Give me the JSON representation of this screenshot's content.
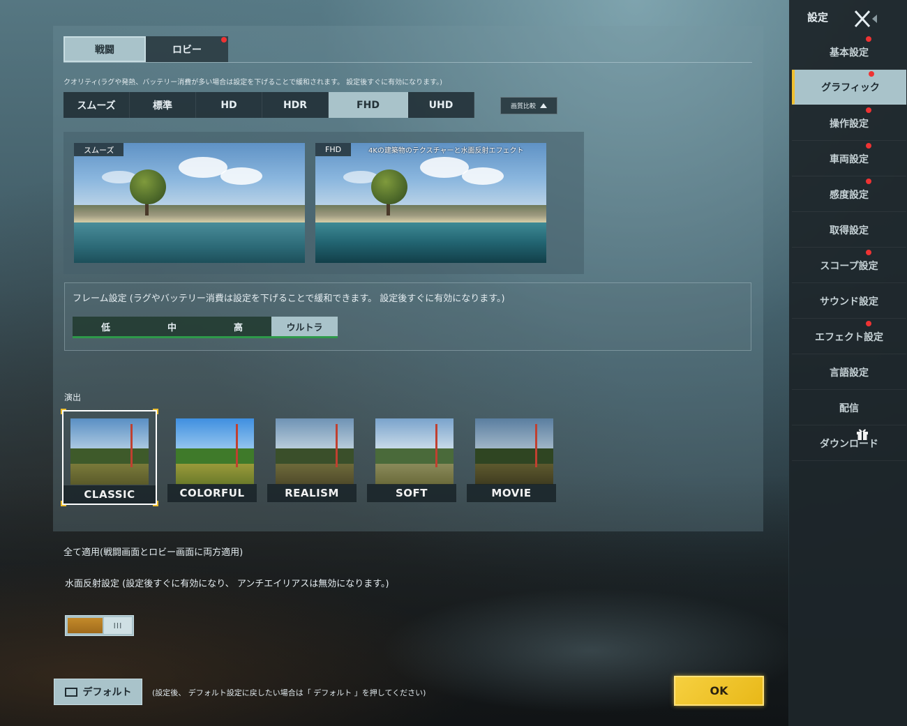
{
  "tabs": [
    {
      "label": "戦闘",
      "active": true
    },
    {
      "label": "ロビー",
      "active": false,
      "badge": true
    }
  ],
  "quality": {
    "note": "クオリティ(ラグや発熱、バッテリー消費が多い場合は設定を下げることで緩和されます。 設定後すぐに有効になります。)",
    "options": [
      "スムーズ",
      "標準",
      "HD",
      "HDR",
      "FHD",
      "UHD"
    ],
    "selected": "FHD",
    "compare_label": "画質比較"
  },
  "preview": {
    "left_label": "スムーズ",
    "right_label": "FHD",
    "right_desc": "4Kの建築物のテクスチャーと水面反射エフェクト"
  },
  "frame": {
    "note": "フレーム設定 (ラグやバッテリー消費は設定を下げることで緩和できます。 設定後すぐに有効になります。)",
    "options": [
      "低",
      "中",
      "高",
      "ウルトラ"
    ],
    "selected": "ウルトラ"
  },
  "style": {
    "title": "演出",
    "options": [
      "CLASSIC",
      "COLORFUL",
      "REALISM",
      "SOFT",
      "MOVIE"
    ],
    "selected": "CLASSIC"
  },
  "apply_all": "全て適用(戦闘画面とロビー画面に両方適用)",
  "water": {
    "note": "水面反射設定 (設定後すぐに有効になり、 アンチエイリアスは無効になります。)",
    "toggle_on": true,
    "knob_glyph": "III"
  },
  "footer": {
    "default_label": "デフォルト",
    "default_note": "(設定後、 デフォルト設定に戻したい場合は「 デフォルト 」を押してください)",
    "ok_label": "OK"
  },
  "sidebar": {
    "title": "設定",
    "items": [
      {
        "label": "基本設定",
        "badge": true
      },
      {
        "label": "グラフィック",
        "badge": true,
        "active": true
      },
      {
        "label": "操作設定",
        "badge": true
      },
      {
        "label": "車両設定",
        "badge": true
      },
      {
        "label": "感度設定",
        "badge": true
      },
      {
        "label": "取得設定",
        "badge": false
      },
      {
        "label": "スコープ設定",
        "badge": true
      },
      {
        "label": "サウンド設定",
        "badge": false
      },
      {
        "label": "エフェクト設定",
        "badge": true
      },
      {
        "label": "言語設定",
        "badge": false
      },
      {
        "label": "配信",
        "badge": false
      },
      {
        "label": "ダウンロード",
        "badge": false,
        "gift": true
      }
    ]
  },
  "colors": {
    "accent": "#a9c3ca",
    "ok": "#f0c030",
    "badge": "#e33333",
    "frame_underline": "#2e9a4a"
  }
}
